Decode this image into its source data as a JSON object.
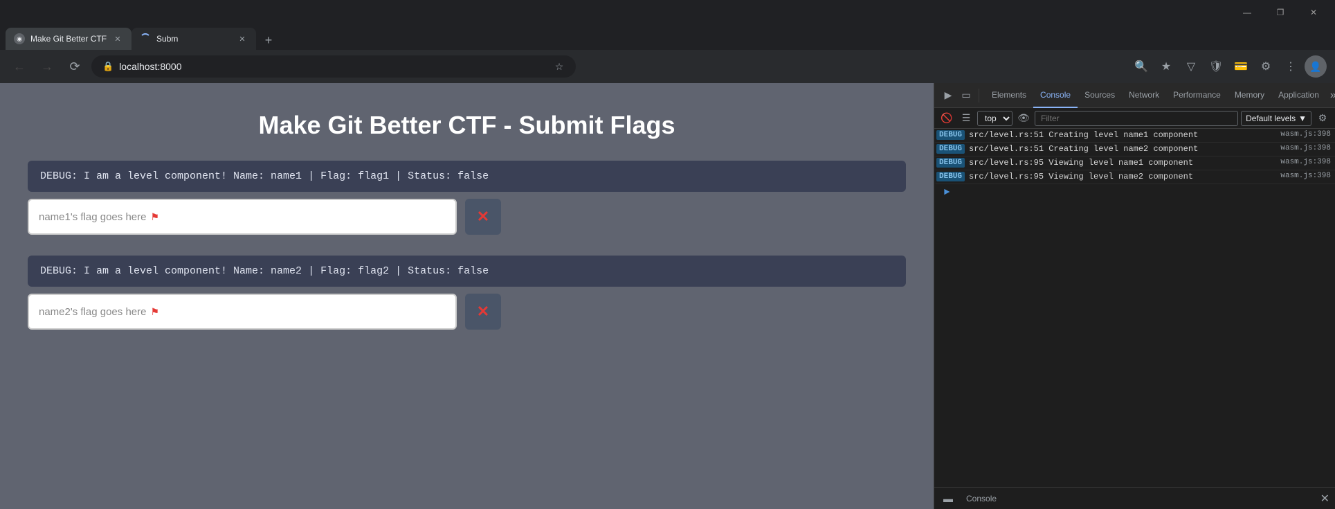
{
  "browser": {
    "tabs": [
      {
        "id": "tab1",
        "title": "Make Git Better CTF",
        "favicon": "◉",
        "active": false,
        "loading": false
      },
      {
        "id": "tab2",
        "title": "Subm",
        "favicon": "◉",
        "active": true,
        "loading": true
      }
    ],
    "new_tab_label": "+",
    "address": "localhost:8000",
    "window_controls": [
      "—",
      "❐",
      "✕"
    ]
  },
  "page": {
    "title": "Make Git Better CTF - Submit Flags",
    "levels": [
      {
        "debug_text": "DEBUG: I am a level component! Name: name1 | Flag: flag1 | Status: false",
        "placeholder": "name1's flag goes here",
        "submit_label": "✕"
      },
      {
        "debug_text": "DEBUG: I am a level component! Name: name2 | Flag: flag2 | Status: false",
        "placeholder": "name2's flag goes here",
        "submit_label": "✕"
      }
    ]
  },
  "devtools": {
    "tabs": [
      "Elements",
      "Console",
      "Sources",
      "Network",
      "Performance",
      "Memory",
      "Application"
    ],
    "active_tab": "Console",
    "more_label": "»",
    "toolbar": {
      "context": "top",
      "filter_placeholder": "Filter",
      "levels_label": "Default levels"
    },
    "console_rows": [
      {
        "type": "debug",
        "badge": "DEBUG",
        "message": "src/level.rs:51 Creating level name1 component",
        "source": "wasm.js:398"
      },
      {
        "type": "debug",
        "badge": "DEBUG",
        "message": "src/level.rs:51 Creating level name2 component",
        "source": "wasm.js:398"
      },
      {
        "type": "debug",
        "badge": "DEBUG",
        "message": "src/level.rs:95 Viewing level name1 component",
        "source": "wasm.js:398"
      },
      {
        "type": "debug",
        "badge": "DEBUG",
        "message": "src/level.rs:95 Viewing level name2 component",
        "source": "wasm.js:398"
      }
    ],
    "bottom_tab": "Console",
    "close_label": "✕"
  }
}
